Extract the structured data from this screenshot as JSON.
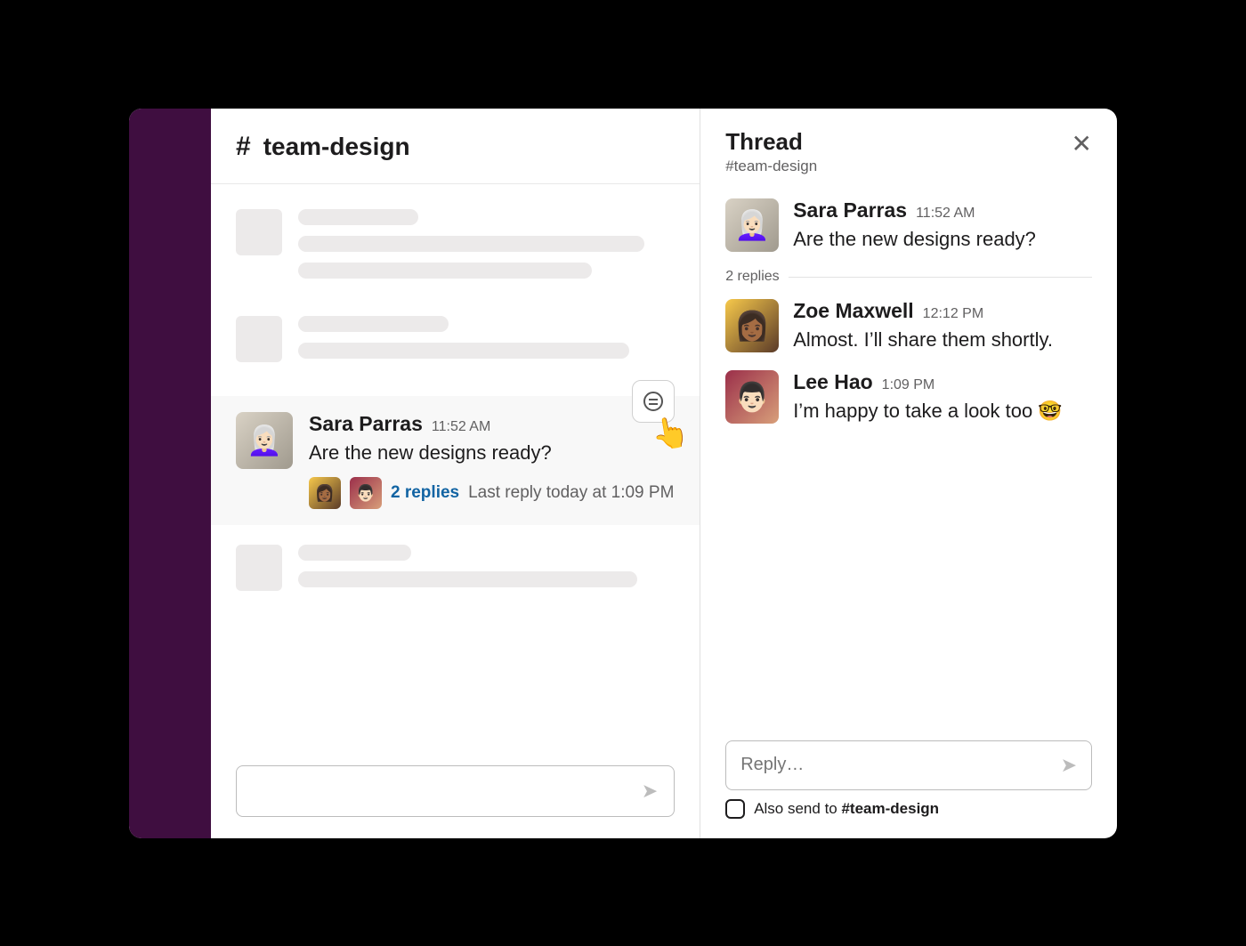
{
  "channel": {
    "hash": "#",
    "name": "team-design"
  },
  "message": {
    "author": "Sara Parras",
    "time": "11:52 AM",
    "text": "Are the new designs ready?",
    "replies_label": "2 replies",
    "last_reply": "Last reply today at 1:09 PM"
  },
  "thread": {
    "title": "Thread",
    "subtitle": "#team-design",
    "reply_count_label": "2 replies",
    "root": {
      "author": "Sara Parras",
      "time": "11:52 AM",
      "text": "Are the new designs ready?"
    },
    "replies": [
      {
        "author": "Zoe Maxwell",
        "time": "12:12 PM",
        "text": "Almost. I’ll share them shortly."
      },
      {
        "author": "Lee Hao",
        "time": "1:09 PM",
        "text": "I’m happy to take a look too 🤓"
      }
    ],
    "reply_placeholder": "Reply…",
    "also_send_prefix": "Also send to ",
    "also_send_channel": "#team-design"
  }
}
